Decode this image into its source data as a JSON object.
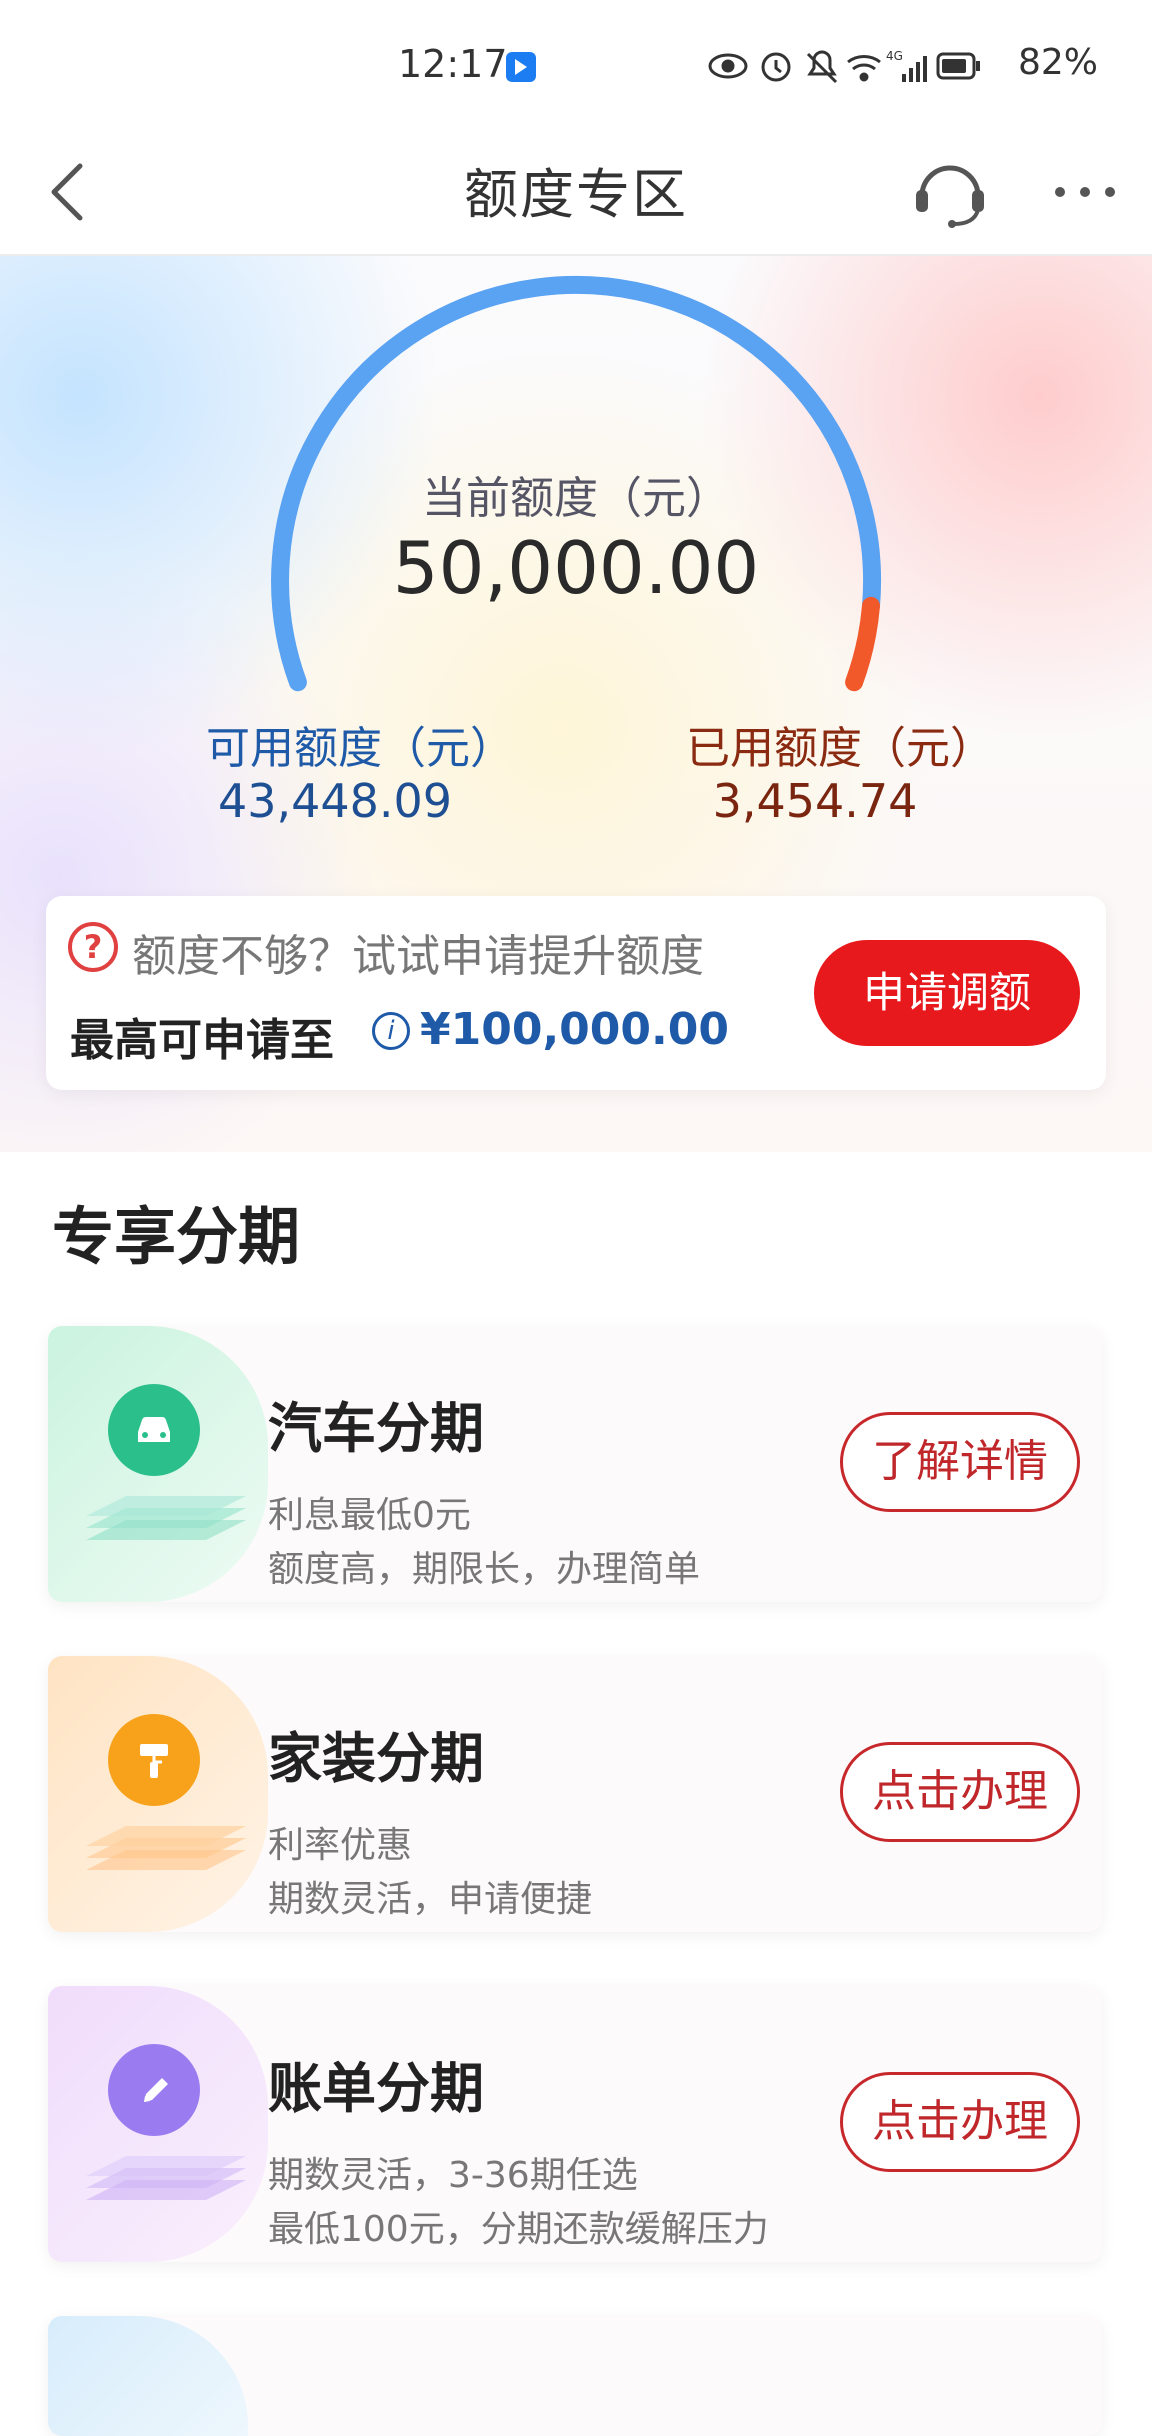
{
  "status_bar": {
    "time": "12:17",
    "battery": "82%",
    "network": "4G"
  },
  "nav": {
    "title": "额度专区",
    "back_icon": "chevron-left-icon",
    "service_icon": "headset-icon",
    "more_icon": "more-dots-icon"
  },
  "credit": {
    "current_label": "当前额度（元）",
    "current_value": "50,000.00",
    "available_label": "可用额度（元）",
    "available_value": "43,448.09",
    "used_label": "已用额度（元）",
    "used_value": "3,454.74",
    "used_fraction": 0.069
  },
  "promo": {
    "hint": "额度不够？试试申请提升额度",
    "max_label": "最高可申请至",
    "max_amount": "¥100,000.00",
    "button": "申请调额"
  },
  "section": {
    "title": "专享分期"
  },
  "cards": [
    {
      "title": "汽车分期",
      "line1": "利息最低0元",
      "line2": "额度高，期限长，办理简单",
      "button": "了解详情",
      "icon": "car-icon",
      "color": "#2bbf8c"
    },
    {
      "title": "家装分期",
      "line1": "利率优惠",
      "line2": "期数灵活，申请便捷",
      "button": "点击办理",
      "icon": "paint-roller-icon",
      "color": "#f7a21a"
    },
    {
      "title": "账单分期",
      "line1": "期数灵活，3-36期任选",
      "line2": "最低100元，分期还款缓解压力",
      "button": "点击办理",
      "icon": "pencil-icon",
      "color": "#9b7cf0"
    }
  ],
  "colors": {
    "accent_red": "#e8191c",
    "gauge_blue": "#5aa2f2",
    "gauge_orange": "#f2592a",
    "available_blue": "#1f4f93",
    "used_brown": "#7a2510"
  }
}
